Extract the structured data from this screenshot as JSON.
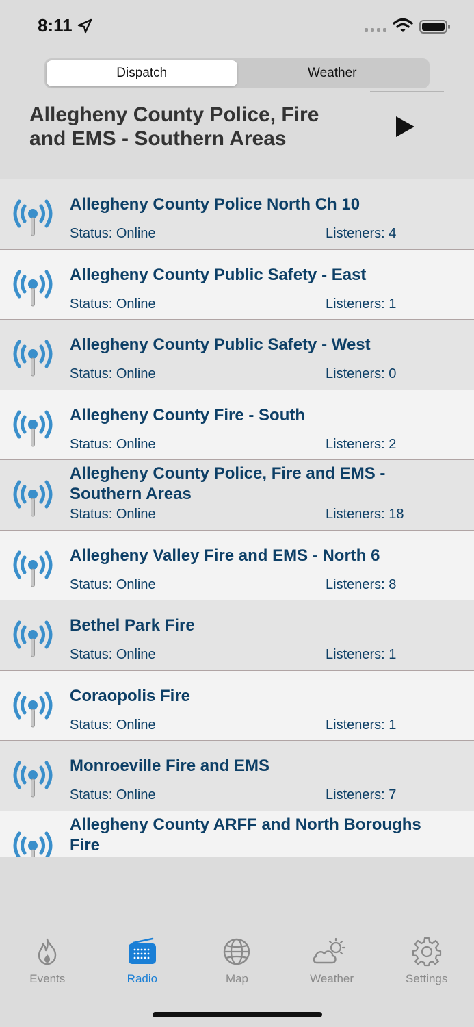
{
  "status_bar": {
    "time": "8:11",
    "icons": [
      "location-arrow-icon",
      "cellular-signal-icon",
      "wifi-icon",
      "battery-icon"
    ]
  },
  "segment": {
    "options": [
      "Dispatch",
      "Weather"
    ],
    "selected": "Dispatch"
  },
  "now_playing": {
    "title": "Allegheny County Police, Fire and EMS - Southern Areas",
    "play_icon": "play-icon"
  },
  "feeds": [
    {
      "name": "Allegheny County Police North Ch 10",
      "status": "Status: Online",
      "listeners": "Listeners: 4"
    },
    {
      "name": "Allegheny County Public Safety - East",
      "status": "Status: Online",
      "listeners": "Listeners: 1"
    },
    {
      "name": "Allegheny County Public Safety - West",
      "status": "Status: Online",
      "listeners": "Listeners: 0"
    },
    {
      "name": "Allegheny County Fire - South",
      "status": "Status: Online",
      "listeners": "Listeners: 2"
    },
    {
      "name": "Allegheny County Police, Fire and EMS - Southern Areas",
      "status": "Status: Online",
      "listeners": "Listeners: 18"
    },
    {
      "name": "Allegheny Valley Fire and EMS - North 6",
      "status": "Status: Online",
      "listeners": "Listeners: 8"
    },
    {
      "name": "Bethel Park Fire",
      "status": "Status: Online",
      "listeners": "Listeners: 1"
    },
    {
      "name": "Coraopolis Fire",
      "status": "Status: Online",
      "listeners": "Listeners: 1"
    },
    {
      "name": "Monroeville Fire and EMS",
      "status": "Status: Online",
      "listeners": "Listeners: 7"
    },
    {
      "name": "Allegheny County ARFF and North Boroughs Fire",
      "status": "",
      "listeners": ""
    }
  ],
  "tab_bar": {
    "tabs": [
      {
        "label": "Events",
        "icon": "flame-icon"
      },
      {
        "label": "Radio",
        "icon": "radio-icon"
      },
      {
        "label": "Map",
        "icon": "globe-icon"
      },
      {
        "label": "Weather",
        "icon": "cloud-sun-icon"
      },
      {
        "label": "Settings",
        "icon": "gear-icon"
      }
    ],
    "active": "Radio"
  },
  "colors": {
    "accent": "#1a7fd6",
    "title_text": "#0d3f66",
    "broadcast_icon": "#3a8fcb"
  }
}
